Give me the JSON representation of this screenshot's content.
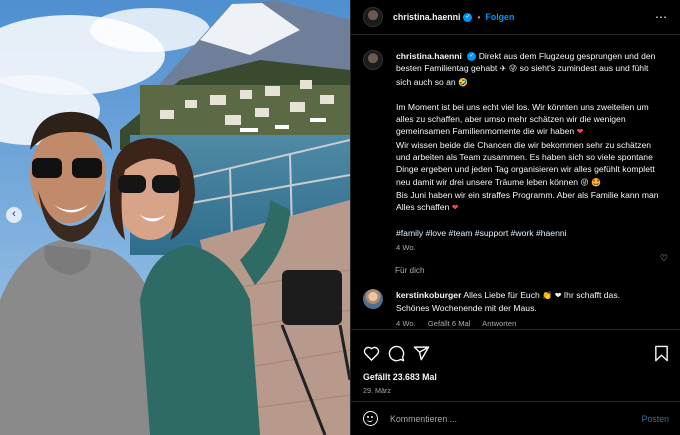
{
  "account": {
    "username": "christina.haenni",
    "verified": true,
    "follow_label": "Folgen",
    "separator": "•"
  },
  "caption": {
    "username": "christina.haenni",
    "line1": "Direkt aus dem Flugzeug gesprungen und den besten Familientag gehabt",
    "line1_emojis": "✈ 😜",
    "line1_tail": "so sieht's zumindest aus und fühlt sich auch so an",
    "line1_end_emoji": "🤣",
    "para2": "Im Moment ist bei uns echt viel los. Wir könnten uns zweiteilen um alles zu schaffen, aber umso mehr schätzen wir die wenigen gemeinsamen Familienmomente die wir haben",
    "para2_emoji": "❤",
    "para3": "Wir wissen beide die Chancen die wir bekommen sehr zu schätzen und arbeiten als Team zusammen. Es haben sich so viele spontane Dinge ergeben und jeden Tag organisieren wir alles gefühlt komplett neu damit wir drei unsere Träume leben können",
    "para3_emoji": "😜 🤩",
    "para4": "Bis Juni haben wir ein straffes Programm. Aber als Familie kann man Alles schaffen",
    "para4_emoji": "❤",
    "hashtags": "#family #love #team #support #work #haenni",
    "age": "4 Wo."
  },
  "see_all_label": "Für dich",
  "comment": {
    "username": "kerstinkoburger",
    "text_a": "Alles Liebe für Euch",
    "emojis": "👏 ❤",
    "text_b": "Ihr schafft das. Schönes Wochenende mit der Maus.",
    "age": "4 Wo.",
    "likes_label": "Gefällt 6 Mal",
    "reply_label": "Antworten"
  },
  "likes_text": "Gefällt 23.683 Mal",
  "post_date": "29. März",
  "compose": {
    "placeholder": "Kommentieren ...",
    "post_label": "Posten"
  },
  "icons": {
    "like": "heart-icon",
    "comment": "comment-icon",
    "share": "share-icon",
    "save": "bookmark-icon",
    "more": "more-icon",
    "emoji": "emoji-icon",
    "carousel_prev": "chevron-left-icon"
  },
  "colors": {
    "accent": "#0095f6",
    "background": "#000000",
    "secondary_text": "#a8a8a8",
    "heart": "#ed4956"
  }
}
